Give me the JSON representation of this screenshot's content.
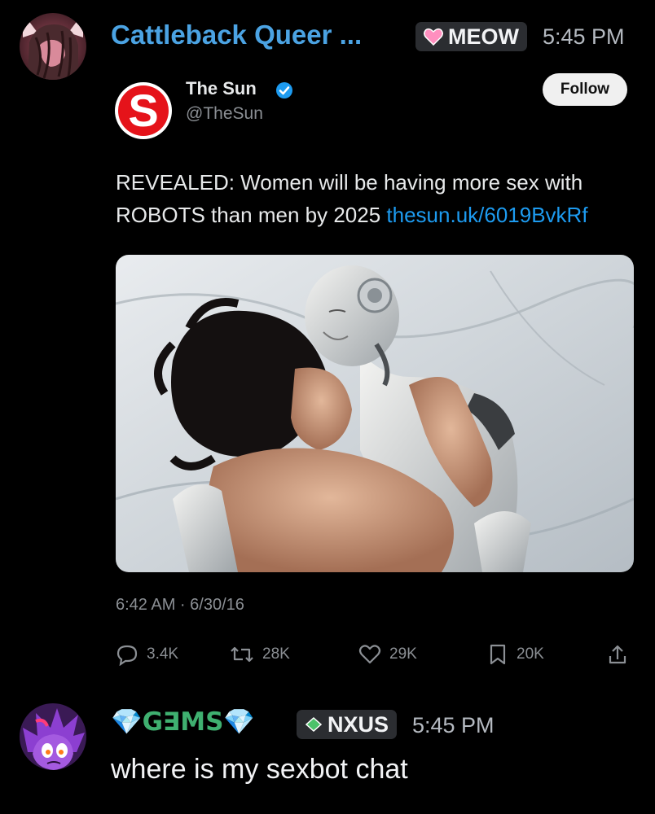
{
  "messages": [
    {
      "author": "Cattleback Queer ...",
      "author_color": "#4ba3e3",
      "tag": {
        "icon": "pink-heart-icon",
        "label": "MEOW"
      },
      "time": "5:45 PM",
      "embed": {
        "type": "tweet-screenshot",
        "account": {
          "name": "The Sun",
          "handle": "@TheSun",
          "verified": true,
          "logo": "S"
        },
        "follow_label": "Follow",
        "text": "REVEALED: Women will be having more sex with ROBOTS than men by 2025",
        "link": "thesun.uk/6019BvkRf",
        "image": "photo of a woman lying beside a white humanoid robot on white bedsheets",
        "date": "6:42 AM · 6/30/16",
        "stats": {
          "replies": "3.4K",
          "retweets": "28K",
          "likes": "29K",
          "bookmarks": "20K"
        }
      }
    },
    {
      "author": "💎G∃MS💎",
      "author_color": "#3fb070",
      "tag": {
        "icon": "green-gem-icon",
        "label": "NXUS"
      },
      "time": "5:45 PM",
      "text": "where is my sexbot chat"
    }
  ]
}
